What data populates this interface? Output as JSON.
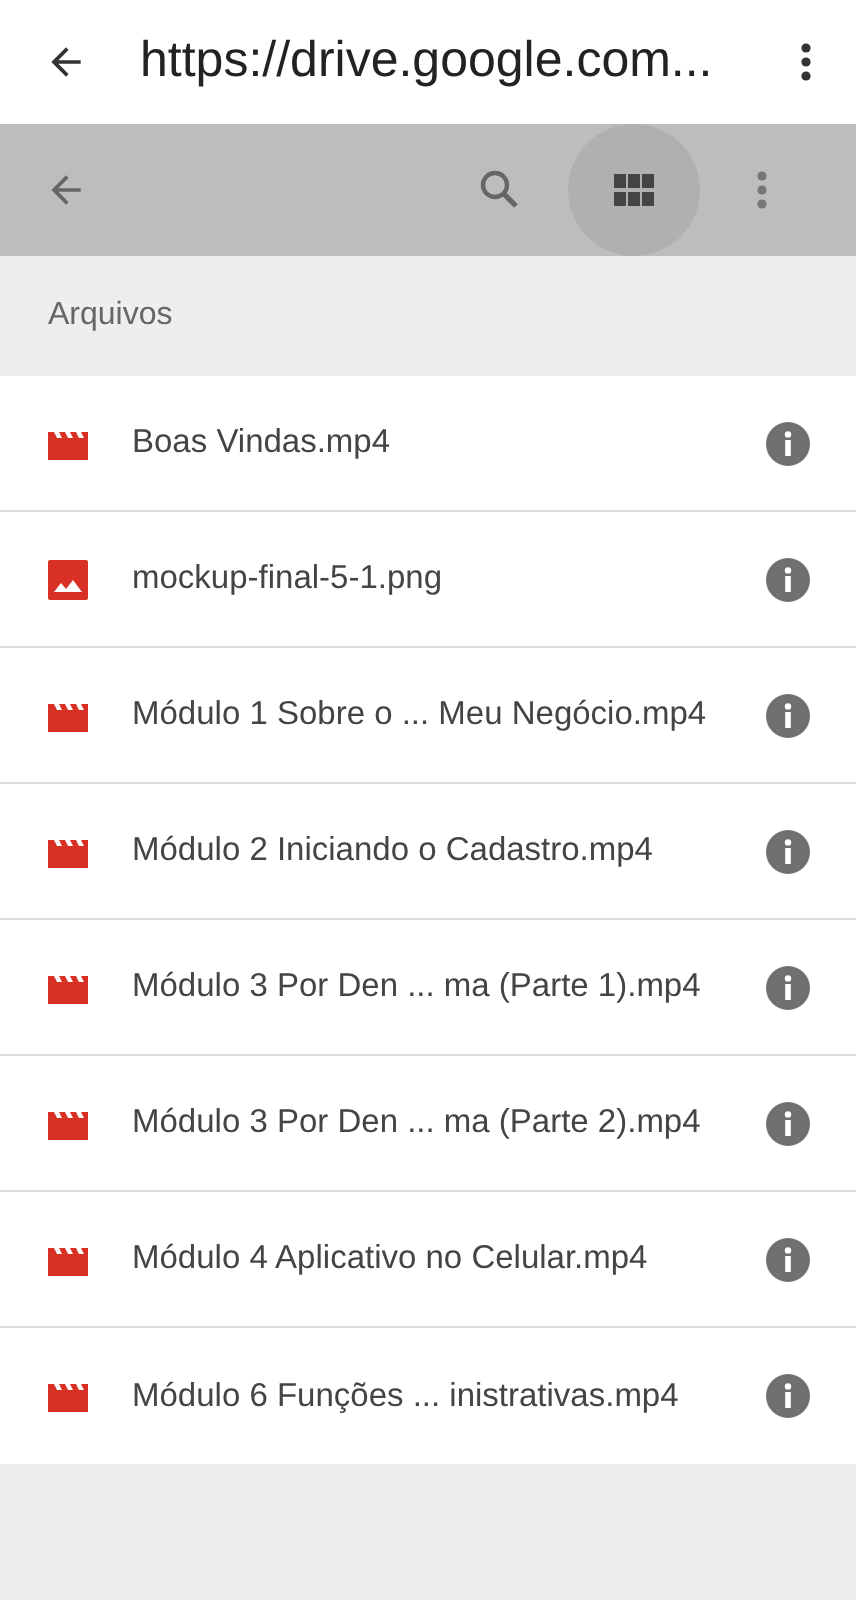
{
  "browser_bar": {
    "url": "https://drive.google.com..."
  },
  "section": {
    "title": "Arquivos"
  },
  "files": [
    {
      "name": "Boas Vindas.mp4",
      "kind": "video"
    },
    {
      "name": "mockup-final-5-1.png",
      "kind": "image"
    },
    {
      "name": "Módulo 1 Sobre o ... Meu Negócio.mp4",
      "kind": "video"
    },
    {
      "name": "Módulo 2 Iniciando o Cadastro.mp4",
      "kind": "video"
    },
    {
      "name": "Módulo 3 Por Den ... ma (Parte 1).mp4",
      "kind": "video"
    },
    {
      "name": "Módulo 3 Por Den ... ma (Parte 2).mp4",
      "kind": "video"
    },
    {
      "name": "Módulo 4 Aplicativo no Celular.mp4",
      "kind": "video"
    },
    {
      "name": "Módulo 6 Funções ... inistrativas.mp4",
      "kind": "video"
    }
  ]
}
